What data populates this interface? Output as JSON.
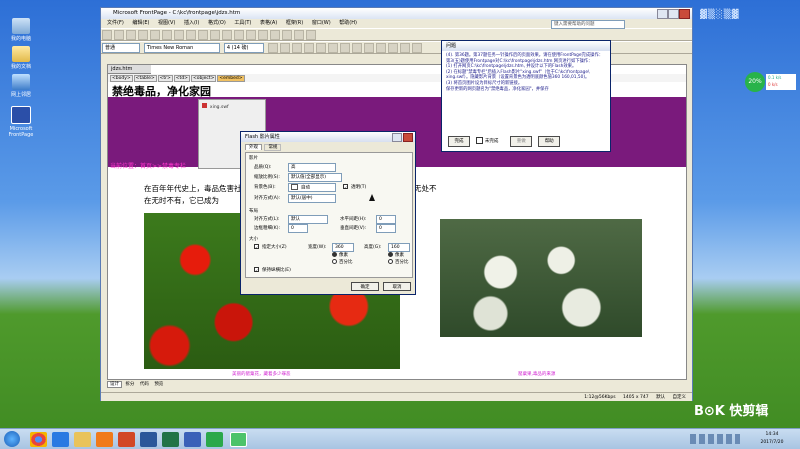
{
  "desktop": {
    "icons": [
      {
        "label": "我的电脑"
      },
      {
        "label": "我的文档"
      },
      {
        "label": "网上邻居"
      },
      {
        "label": "Microsoft FrontPage"
      }
    ],
    "search_placeholder": "输入搜索关键字",
    "speed_widget": {
      "percent": "20%",
      "up": "0.1 k/s",
      "down": "0 k/s"
    },
    "watermark": "快剪辑"
  },
  "frontpage": {
    "title": "Microsoft FrontPage - C:\\kc\\frontpage\\jdzs.htm",
    "menu": [
      "文件(F)",
      "编辑(E)",
      "视图(V)",
      "插入(I)",
      "格式(O)",
      "工具(T)",
      "表格(A)",
      "框架(R)",
      "窗口(W)",
      "帮助(H)"
    ],
    "style_select": "普通",
    "font_select": "Times New Roman",
    "size_select": "4 (14 磅)",
    "search_box": "键入需要帮助的问题",
    "doc_tab": "jdzs.htm",
    "tag_path": [
      "<body>",
      "<table>",
      "<tr>",
      "<td>",
      "<object>",
      "<embed>"
    ],
    "page": {
      "heading": "禁绝毒品，净化家园",
      "flash_placeholder": "xing.swf",
      "breadcrumb": "当前位置：首页>>禁毒专栏",
      "paragraph_line1": "在百年年代史上，毒品危害社会，人民生活等社会各个领域和各个阶层。毒品几乎无处不",
      "paragraph_line2": "在无时不有，它已成为",
      "caption_left": "美丽的罂粟花，藏着多少罪恶",
      "caption_right": "罂粟果,毒品的来源"
    },
    "view_tabs": [
      "设计",
      "拆分",
      "代码",
      "预览"
    ],
    "status": {
      "speed": "1:12@56Kbps",
      "size": "1405 x 747",
      "mode": "默认",
      "custom": "自定义"
    }
  },
  "flash_dialog": {
    "title": "Flash 影片属性",
    "tabs": [
      "外观",
      "常规"
    ],
    "section_movie": "影片",
    "quality_label": "品质(Q):",
    "quality_value": "高",
    "scale_label": "缩放比例(S):",
    "scale_value": "默认值(全部显示)",
    "background_label": "背景色(B):",
    "background_value": "自动",
    "transparent_label": "透明(T)",
    "align_label": "对齐方式(A):",
    "align_value": "默认(居中)",
    "section_layout": "布局",
    "float_label": "对齐方式(L):",
    "float_value": "默认",
    "border_label": "边框粗细(K):",
    "border_value": "0",
    "hspace_label": "水平间距(H):",
    "hspace_value": "0",
    "vspace_label": "垂直间距(V):",
    "vspace_value": "0",
    "section_size": "大小",
    "specify_size_label": "指定大小(Z)",
    "width_label": "宽度(W):",
    "width_value": "360",
    "height_label": "高度(G):",
    "height_value": "160",
    "unit_px": "像素",
    "unit_pct": "百分比",
    "keep_ratio_label": "保持纵横比(E)",
    "ok": "确定",
    "cancel": "取消"
  },
  "question_panel": {
    "title": "问题",
    "text": "(4). 第36题。第37题任务一针操作后的页面效果。请在使用FrontPage完成操作：第3(五)题使用Frontpage对C:\\kc\\frontpage\\jdzs.htm 网页进行如下操作：\n(1) 打开网页C:\\kc\\frontpage\\jdzs.htm, 并设计以下的Flash效果。\n(2) 在标题\"禁毒专栏\"后插入Flash影片\"xing.swf\"（位于C:\\kc\\frontpage\\ xing.swf）。隐藏影片背景（设置背景色为透明底颜色值360 160,01,50)。\n(3) 将首页图片设为目标尺寸的新链接。\n保存更新的网页题名为\"禁绝毒品，净化家园\"，并保存",
    "done": "完成",
    "no_save": "未完成",
    "redo": "重做",
    "help": "帮助"
  },
  "taskbar": {
    "clock_time": "14:34",
    "clock_date": "2017/7/20"
  }
}
